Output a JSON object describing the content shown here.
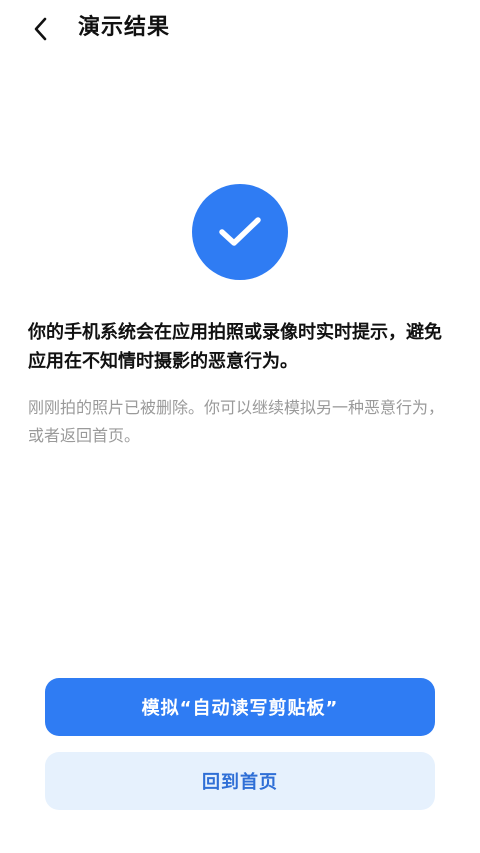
{
  "header": {
    "title": "演示结果",
    "back_icon": "chevron-left-icon"
  },
  "result": {
    "icon": "check-icon",
    "icon_bg_color": "#2f7cf3",
    "message": "你的手机系统会在应用拍照或录像时实时提示，避免应用在不知情时摄影的恶意行为。",
    "subtext": "刚刚拍的照片已被删除。你可以继续模拟另一种恶意行为，或者返回首页。"
  },
  "actions": {
    "primary_label": "模拟“自动读写剪贴板”",
    "secondary_label": "回到首页",
    "primary_color": "#2f7cf3",
    "secondary_bg_color": "#e6f1fd"
  }
}
